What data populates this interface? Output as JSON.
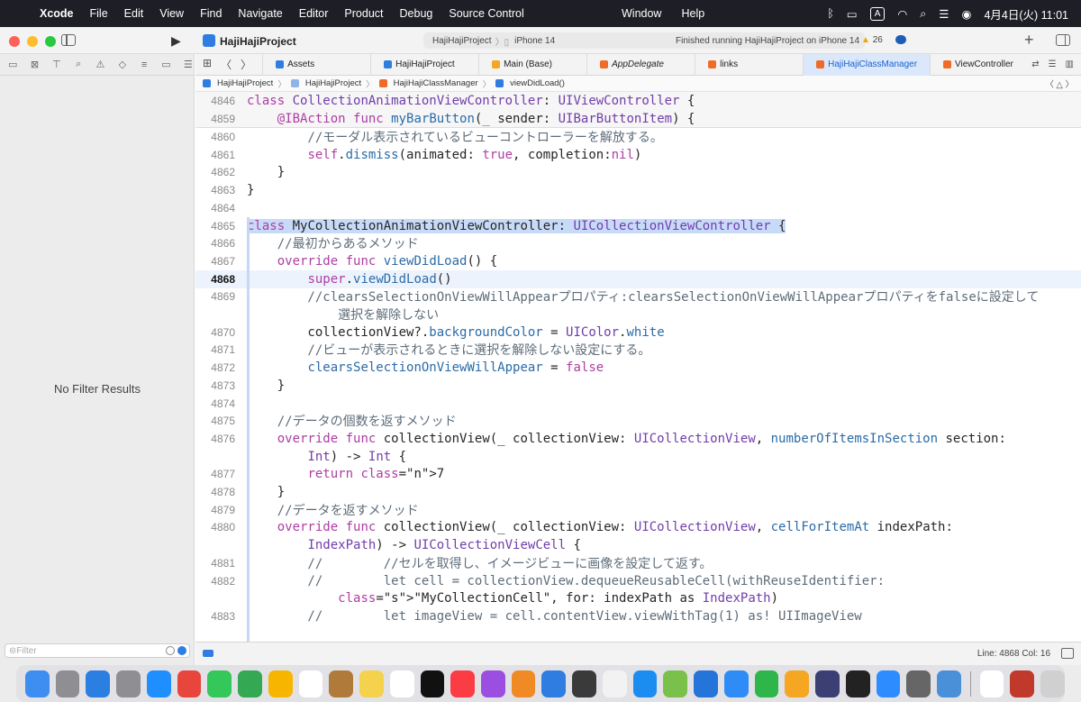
{
  "menubar": {
    "app_name": "Xcode",
    "items": [
      "File",
      "Edit",
      "View",
      "Find",
      "Navigate",
      "Editor",
      "Product",
      "Debug",
      "Source Control"
    ],
    "center_items": [
      "Window",
      "Help"
    ],
    "input_source": "A",
    "clock": "4月4日(火)  11:01"
  },
  "toolbar": {
    "project_name": "HajiHajiProject",
    "scheme": "HajiHajiProject",
    "device": "iPhone 14",
    "status": "Finished running HajiHajiProject on iPhone 14",
    "warnings": "26"
  },
  "navigator": {
    "empty_text": "No Filter Results",
    "filter_placeholder": "Filter"
  },
  "tabs": [
    {
      "label": "Assets",
      "icon": "asset-catalog-icon",
      "active": false
    },
    {
      "label": "HajiHajiProject",
      "icon": "project-icon",
      "active": false
    },
    {
      "label": "Main (Base)",
      "icon": "storyboard-icon",
      "active": false
    },
    {
      "label": "AppDelegate",
      "icon": "swift-icon",
      "active": false
    },
    {
      "label": "links",
      "icon": "swift-icon",
      "active": false
    },
    {
      "label": "HajiHajiClassManager",
      "icon": "swift-icon",
      "active": true
    },
    {
      "label": "ViewController",
      "icon": "swift-icon",
      "active": false
    }
  ],
  "jumpbar": [
    "HajiHajiProject",
    "HajiHajiProject",
    "HajiHajiClassManager",
    "viewDidLoad()"
  ],
  "editor": {
    "sticky": [
      {
        "num": "4846",
        "code": "class CollectionAnimationViewController: UIViewController {"
      },
      {
        "num": "4859",
        "code": "    @IBAction func myBarButton(_ sender: UIBarButtonItem) {"
      }
    ],
    "lines": [
      {
        "num": "4860",
        "code": "        //モーダル表示されているビューコントローラーを解放する。"
      },
      {
        "num": "4861",
        "code": "        self.dismiss(animated: true, completion:nil)"
      },
      {
        "num": "4862",
        "code": "    }"
      },
      {
        "num": "4863",
        "code": "}"
      },
      {
        "num": "4864",
        "code": ""
      },
      {
        "num": "4865",
        "code": "class MyCollectionAnimationViewController: UICollectionViewController {"
      },
      {
        "num": "4866",
        "code": "    //最初からあるメソッド"
      },
      {
        "num": "4867",
        "code": "    override func viewDidLoad() {"
      },
      {
        "num": "4868",
        "code": "        super.viewDidLoad()"
      },
      {
        "num": "4869",
        "code": "        //clearsSelectionOnViewWillAppearプロパティ:clearsSelectionOnViewWillAppearプロパティをfalseに設定して"
      },
      {
        "num": "",
        "code": "            選択を解除しない"
      },
      {
        "num": "4870",
        "code": "        collectionView?.backgroundColor = UIColor.white"
      },
      {
        "num": "4871",
        "code": "        //ビューが表示されるときに選択を解除しない設定にする。"
      },
      {
        "num": "4872",
        "code": "        clearsSelectionOnViewWillAppear = false"
      },
      {
        "num": "4873",
        "code": "    }"
      },
      {
        "num": "4874",
        "code": ""
      },
      {
        "num": "4875",
        "code": "    //データの個数を返すメソッド"
      },
      {
        "num": "4876",
        "code": "    override func collectionView(_ collectionView: UICollectionView, numberOfItemsInSection section:"
      },
      {
        "num": "",
        "code": "        Int) -> Int {"
      },
      {
        "num": "4877",
        "code": "        return 7"
      },
      {
        "num": "4878",
        "code": "    }"
      },
      {
        "num": "4879",
        "code": "    //データを返すメソッド"
      },
      {
        "num": "4880",
        "code": "    override func collectionView(_ collectionView: UICollectionView, cellForItemAt indexPath:"
      },
      {
        "num": "",
        "code": "        IndexPath) -> UICollectionViewCell {"
      },
      {
        "num": "4881",
        "code": "        //        //セルを取得し、イメージビューに画像を設定して返す。"
      },
      {
        "num": "4882",
        "code": "        //        let cell = collectionView.dequeueReusableCell(withReuseIdentifier:"
      },
      {
        "num": "",
        "code": "            \"MyCollectionCell\", for: indexPath as IndexPath)"
      },
      {
        "num": "4883",
        "code": "        //        let imageView = cell.contentView.viewWithTag(1) as! UIImageView"
      }
    ]
  },
  "debugbar": {
    "position": "Line: 4868  Col: 16"
  },
  "dock": [
    "finder-icon",
    "launchpad-icon",
    "mail-icon",
    "system-settings-icon",
    "safari-icon",
    "chrome-icon",
    "messages-icon",
    "maps-icon",
    "photos-icon",
    "calendar-icon",
    "archive-icon",
    "notes-icon",
    "reminders-icon",
    "tv-icon",
    "music-icon",
    "podcasts-icon",
    "books-icon",
    "xcode-icon",
    "instruments-icon",
    "file-icon",
    "appstore-icon",
    "sketch-icon",
    "vscode-icon",
    "keynote-icon",
    "numbers-icon",
    "pages-icon",
    "app-icon",
    "terminal-icon",
    "zoom-icon",
    "calculator-icon",
    "simulator-icon",
    "textedit-icon",
    "dictionary-icon",
    "trash-icon"
  ]
}
